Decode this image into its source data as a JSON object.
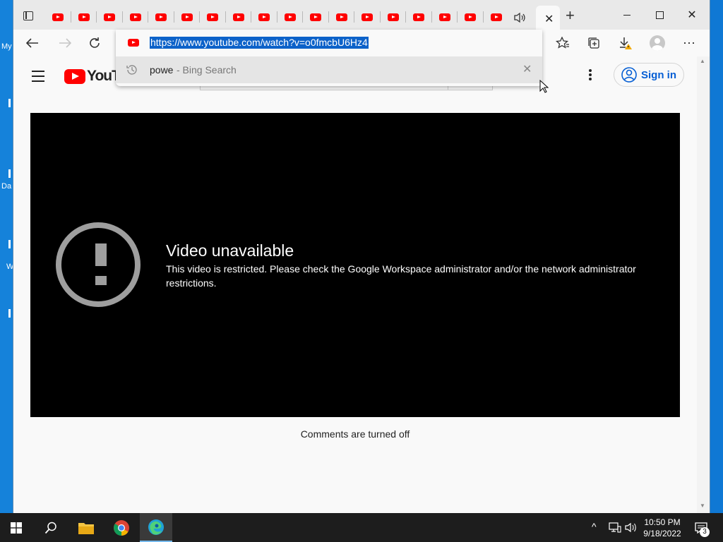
{
  "desktop": {
    "labels": [
      "My",
      "Da",
      "W"
    ]
  },
  "browser": {
    "url": "https://www.youtube.com/watch?v=o0fmcbU6Hz4",
    "suggestion": {
      "query": "powe",
      "source": " - Bing Search"
    }
  },
  "youtube": {
    "logo_text": "YouTu",
    "sign_in": "Sign in",
    "error_title": "Video unavailable",
    "error_message": "This video is restricted. Please check the Google Workspace administrator and/or the network administrator restrictions.",
    "comments_off": "Comments are turned off"
  },
  "taskbar": {
    "time": "10:50 PM",
    "date": "9/18/2022",
    "notifications": "3"
  },
  "colors": {
    "youtube_red": "#ff0000",
    "signin_blue": "#065fd4",
    "selection": "#0c62c9",
    "desktop": "#0f78d4"
  }
}
